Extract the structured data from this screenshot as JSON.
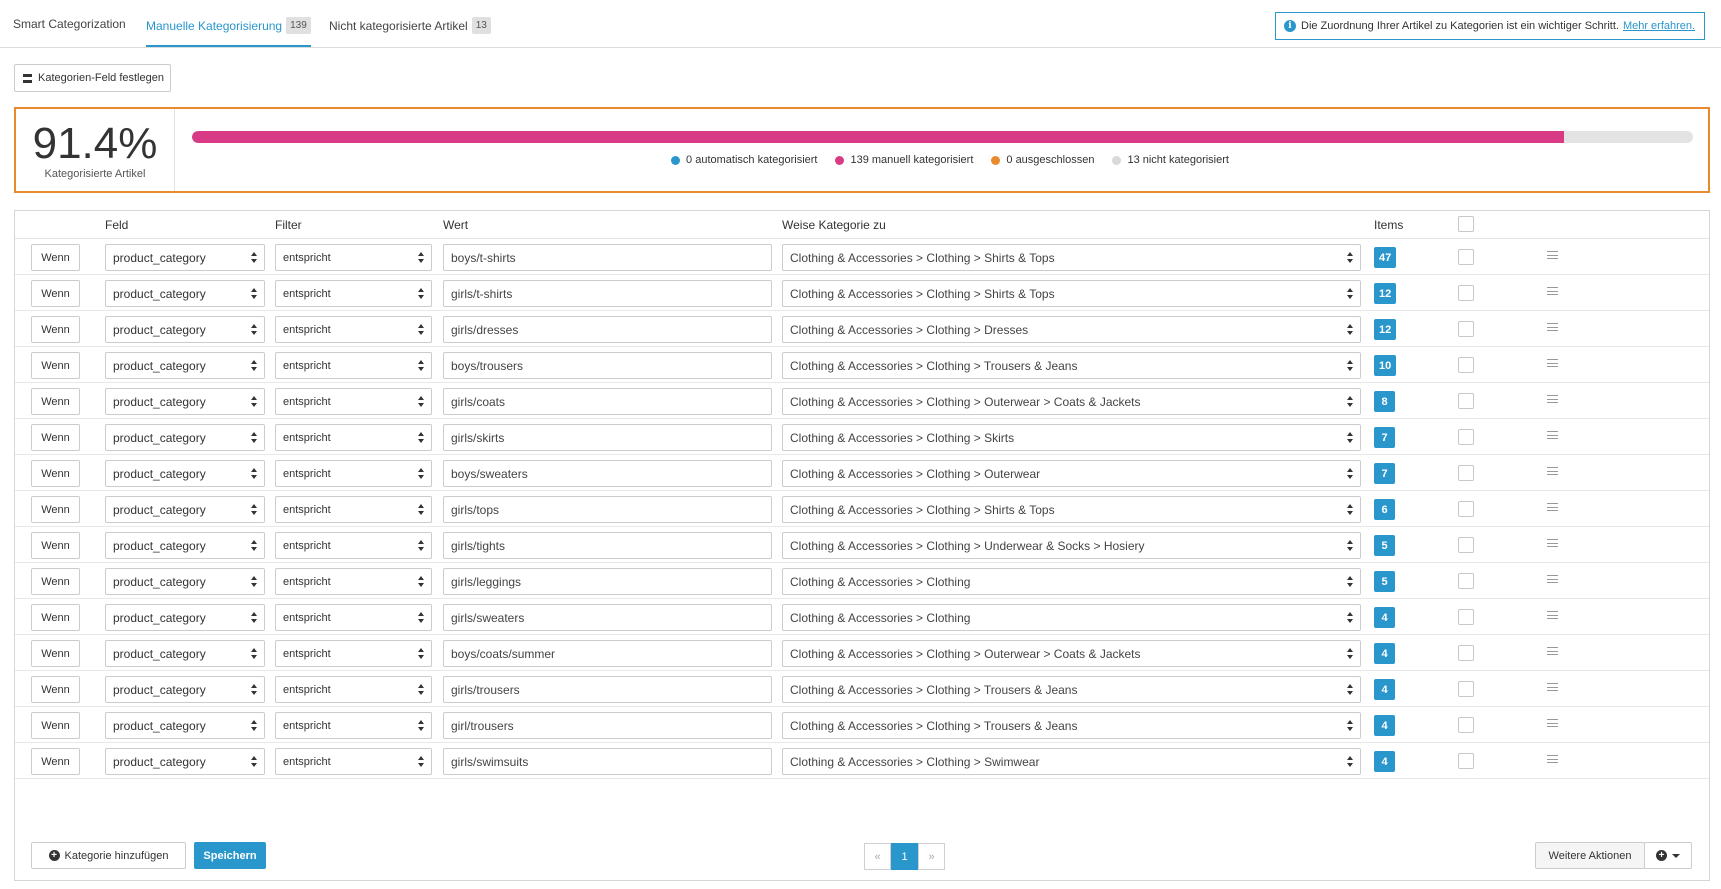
{
  "tabs": [
    {
      "label": "Smart Categorization",
      "count": ""
    },
    {
      "label": "Manuelle Kategorisierung",
      "count": "139"
    },
    {
      "label": "Nicht kategorisierte Artikel",
      "count": "13"
    }
  ],
  "info": {
    "text": "Die Zuordnung Ihrer Artikel zu Kategorien ist ein wichtiger Schritt.",
    "link": "Mehr erfahren."
  },
  "toolbar": {
    "field_button": "Kategorien-Feld festlegen"
  },
  "stats": {
    "percent": "91.4%",
    "label": "Kategorisierte Artikel",
    "progress_fraction": 0.914,
    "legend": [
      {
        "text": "0 automatisch kategorisiert",
        "color": "#2996cc"
      },
      {
        "text": "139 manuell kategorisiert",
        "color": "#d83a86"
      },
      {
        "text": "0 ausgeschlossen",
        "color": "#e98a2f"
      },
      {
        "text": "13 nicht kategorisiert",
        "color": "#d9d9d9"
      }
    ]
  },
  "table": {
    "headers": {
      "feld": "Feld",
      "filter": "Filter",
      "wert": "Wert",
      "kategorie": "Weise Kategorie zu",
      "items": "Items"
    },
    "rows": [
      {
        "cond": "Wenn",
        "field": "product_category",
        "filter": "entspricht",
        "value": "boys/t-shirts",
        "category": "Clothing & Accessories > Clothing > Shirts & Tops",
        "items": "47"
      },
      {
        "cond": "Wenn",
        "field": "product_category",
        "filter": "entspricht",
        "value": "girls/t-shirts",
        "category": "Clothing & Accessories > Clothing > Shirts & Tops",
        "items": "12"
      },
      {
        "cond": "Wenn",
        "field": "product_category",
        "filter": "entspricht",
        "value": "girls/dresses",
        "category": "Clothing & Accessories > Clothing > Dresses",
        "items": "12"
      },
      {
        "cond": "Wenn",
        "field": "product_category",
        "filter": "entspricht",
        "value": "boys/trousers",
        "category": "Clothing & Accessories > Clothing > Trousers & Jeans",
        "items": "10"
      },
      {
        "cond": "Wenn",
        "field": "product_category",
        "filter": "entspricht",
        "value": "girls/coats",
        "category": "Clothing & Accessories > Clothing > Outerwear > Coats & Jackets",
        "items": "8"
      },
      {
        "cond": "Wenn",
        "field": "product_category",
        "filter": "entspricht",
        "value": "girls/skirts",
        "category": "Clothing & Accessories > Clothing > Skirts",
        "items": "7"
      },
      {
        "cond": "Wenn",
        "field": "product_category",
        "filter": "entspricht",
        "value": "boys/sweaters",
        "category": "Clothing & Accessories > Clothing > Outerwear",
        "items": "7"
      },
      {
        "cond": "Wenn",
        "field": "product_category",
        "filter": "entspricht",
        "value": "girls/tops",
        "category": "Clothing & Accessories > Clothing > Shirts & Tops",
        "items": "6"
      },
      {
        "cond": "Wenn",
        "field": "product_category",
        "filter": "entspricht",
        "value": "girls/tights",
        "category": "Clothing & Accessories > Clothing > Underwear & Socks > Hosiery",
        "items": "5"
      },
      {
        "cond": "Wenn",
        "field": "product_category",
        "filter": "entspricht",
        "value": "girls/leggings",
        "category": "Clothing & Accessories > Clothing",
        "items": "5"
      },
      {
        "cond": "Wenn",
        "field": "product_category",
        "filter": "entspricht",
        "value": "girls/sweaters",
        "category": "Clothing & Accessories > Clothing",
        "items": "4"
      },
      {
        "cond": "Wenn",
        "field": "product_category",
        "filter": "entspricht",
        "value": "boys/coats/summer",
        "category": "Clothing & Accessories > Clothing > Outerwear > Coats & Jackets",
        "items": "4"
      },
      {
        "cond": "Wenn",
        "field": "product_category",
        "filter": "entspricht",
        "value": "girls/trousers",
        "category": "Clothing & Accessories > Clothing > Trousers & Jeans",
        "items": "4"
      },
      {
        "cond": "Wenn",
        "field": "product_category",
        "filter": "entspricht",
        "value": "girl/trousers",
        "category": "Clothing & Accessories > Clothing > Trousers & Jeans",
        "items": "4"
      },
      {
        "cond": "Wenn",
        "field": "product_category",
        "filter": "entspricht",
        "value": "girls/swimsuits",
        "category": "Clothing & Accessories > Clothing > Swimwear",
        "items": "4"
      }
    ]
  },
  "footer": {
    "add_label": "Kategorie hinzufügen",
    "save_label": "Speichern",
    "pager": {
      "prev": "«",
      "current": "1",
      "next": "»"
    },
    "more_label": "Weitere Aktionen"
  }
}
